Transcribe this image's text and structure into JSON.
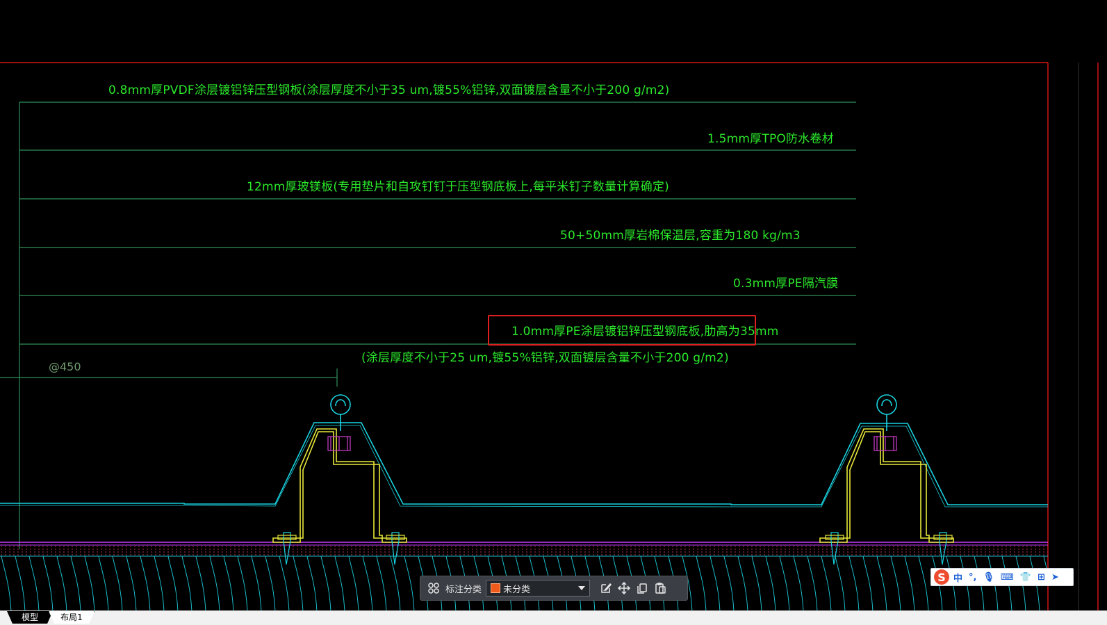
{
  "drawing": {
    "notes": {
      "n1": "0.8mm厚PVDF涂层镀铝锌压型钢板(涂层厚度不小于35 um,镀55%铝锌,双面镀层含量不小于200 g/m2)",
      "n2": "1.5mm厚TPO防水卷材",
      "n3": "12mm厚玻镁板(专用垫片和自攻钉钉于压型钢底板上,每平米钉子数量计算确定)",
      "n4": "50+50mm厚岩棉保温层,容重为180 kg/m3",
      "n5": "0.3mm厚PE隔汽膜",
      "n6": "1.0mm厚PE涂层镀铝锌压型钢底板,肋高为35mm",
      "n7": "(涂层厚度不小于25 um,镀55%铝锌,双面镀层含量不小于200 g/m2)"
    },
    "spacing_label": "@450",
    "colors": {
      "text": "#2be82b",
      "leader_line": "#2f8f5a",
      "profile": "#19d3e0",
      "bracket": "#e8e83a",
      "bolt": "#d23cd2",
      "frame": "#d01515",
      "highlight": "#e02020"
    }
  },
  "toolbar": {
    "grid_icon": "grid-icon",
    "label": "标注分类",
    "category_value": "未分类",
    "actions": [
      "edit-icon",
      "move-icon",
      "copy-icon",
      "paste-icon"
    ]
  },
  "ime": {
    "logo": "S",
    "items": [
      "中",
      "°,",
      "🎙",
      "⌨",
      "👕",
      "⊞",
      "➤"
    ]
  },
  "tabs": {
    "model": "模型",
    "layout1": "布局1"
  }
}
